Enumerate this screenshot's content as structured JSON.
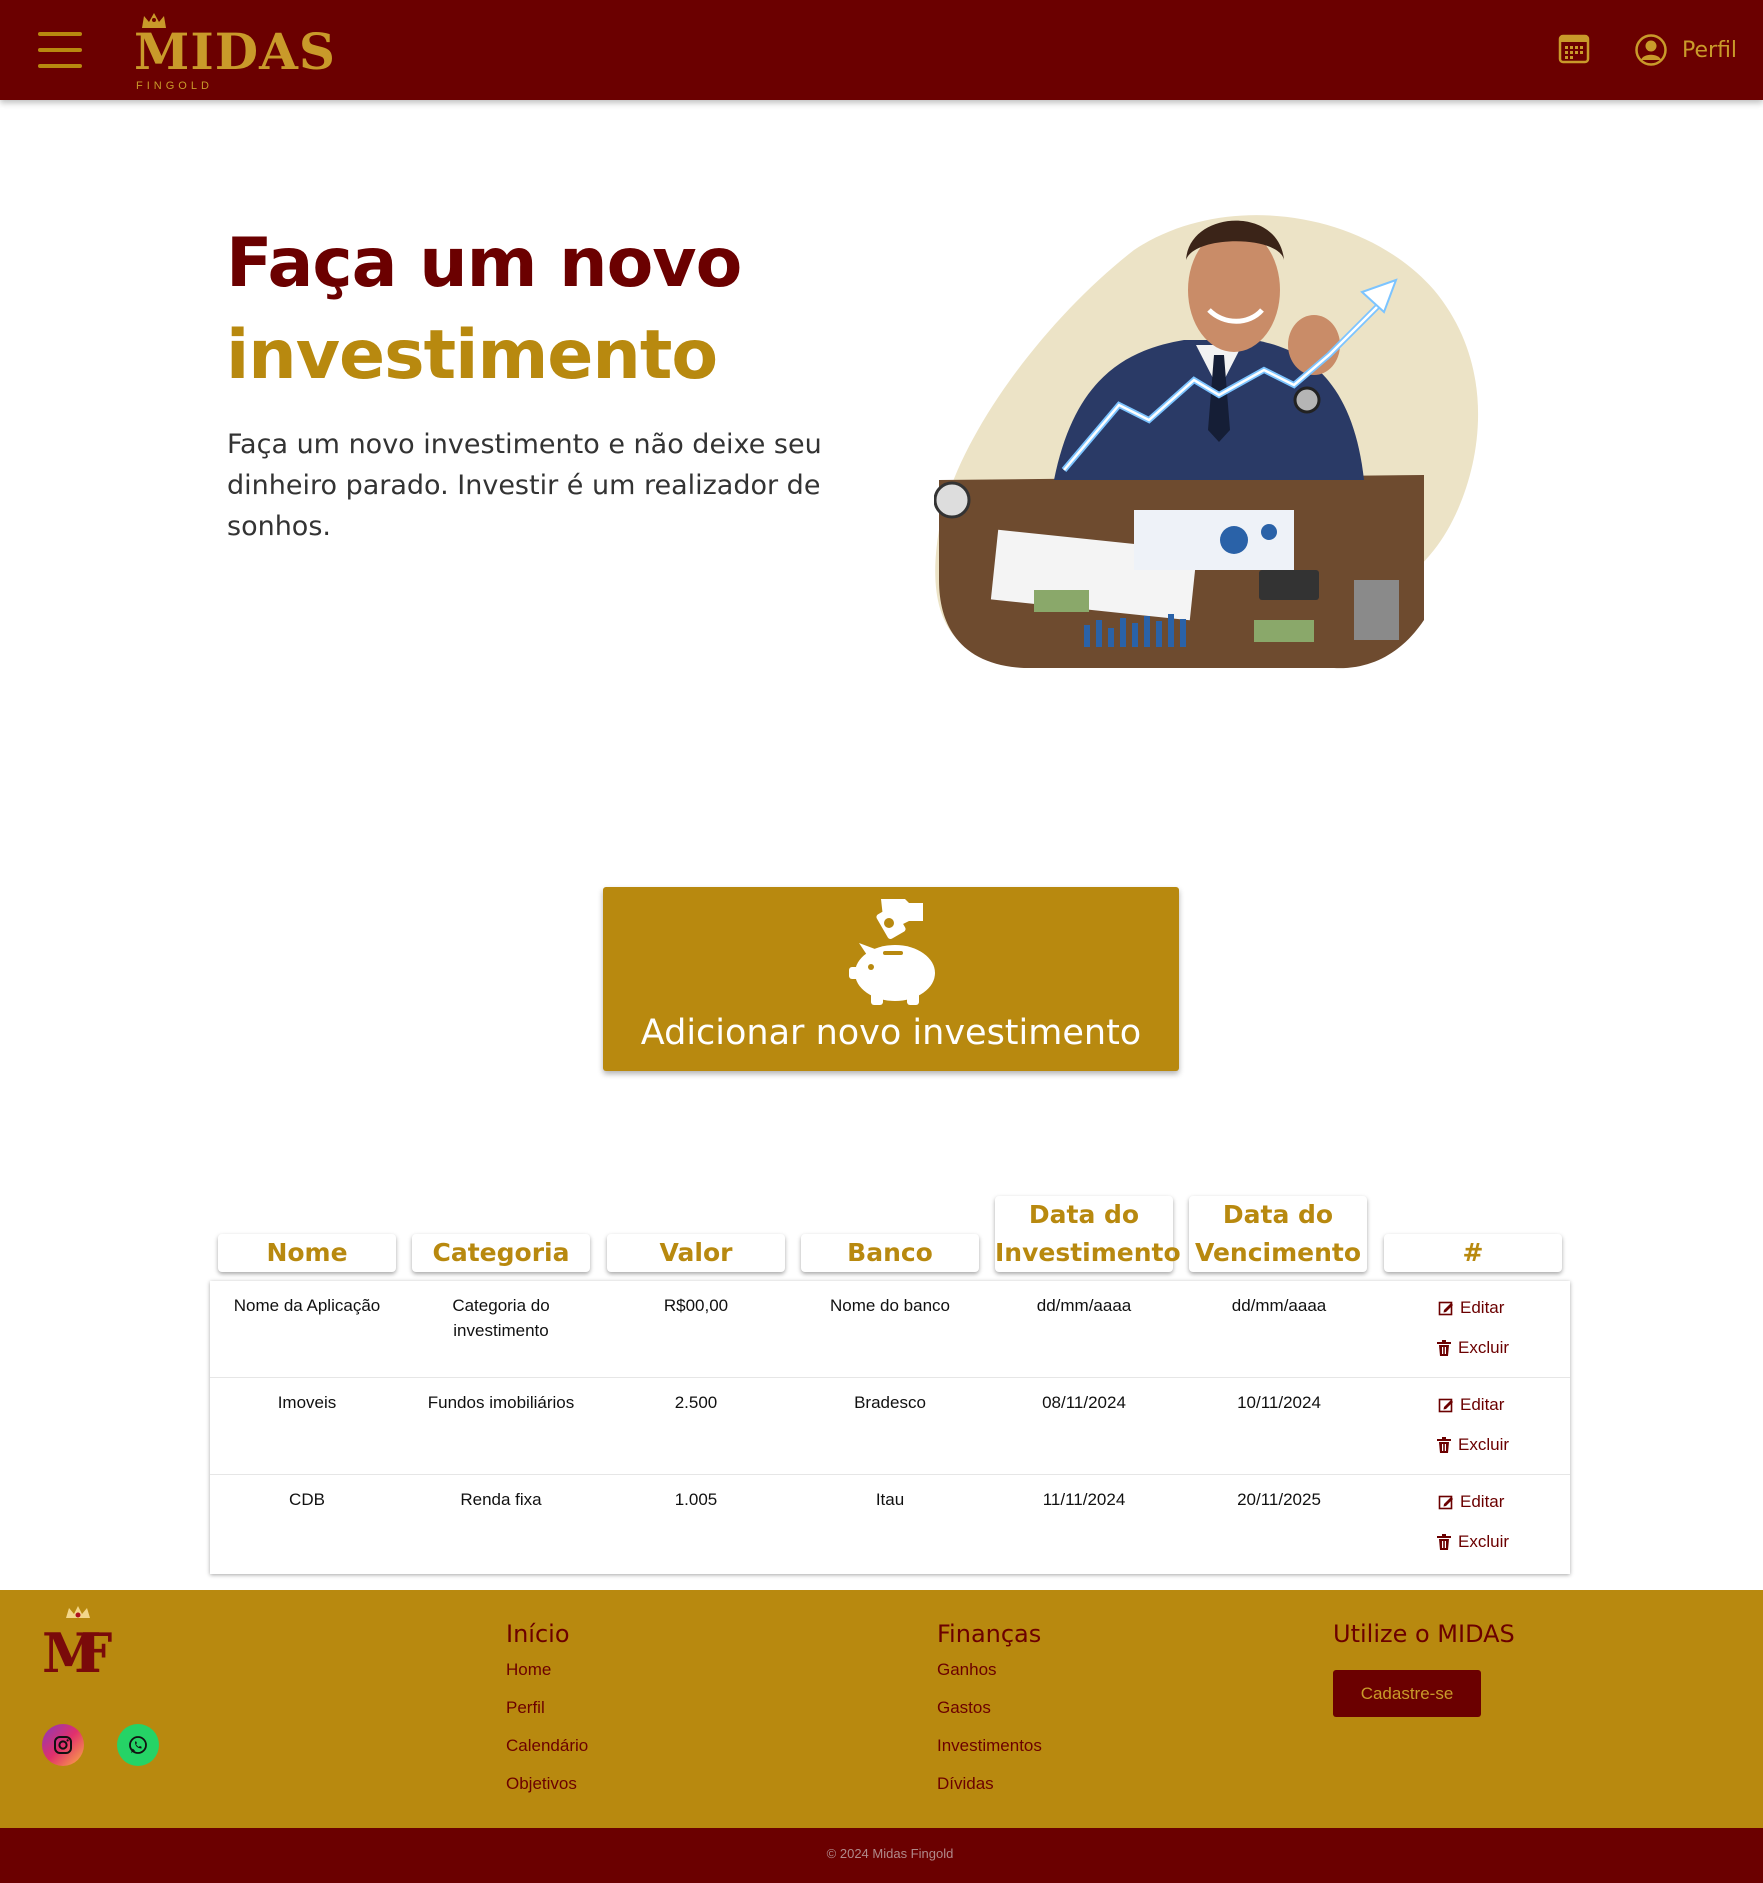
{
  "header": {
    "logo_text": "MIDAS",
    "logo_sub": "FINGOLD",
    "profile_label": "Perfil"
  },
  "hero": {
    "title_line1": "Faça um novo",
    "title_line2": "investimento",
    "description": "Faça um novo investimento e não deixe seu dinheiro parado. Investir é um realizador de sonhos."
  },
  "add_button": {
    "label": "Adicionar novo investimento"
  },
  "table": {
    "headers": [
      {
        "line1": "Nome",
        "line2": ""
      },
      {
        "line1": "Categoria",
        "line2": ""
      },
      {
        "line1": "Valor",
        "line2": ""
      },
      {
        "line1": "Banco",
        "line2": ""
      },
      {
        "line1": "Data do",
        "line2": "Investimento"
      },
      {
        "line1": "Data do",
        "line2": "Vencimento"
      },
      {
        "line1": "#",
        "line2": ""
      }
    ],
    "rows": [
      {
        "nome": "Nome da Aplicação",
        "categoria": "Categoria do investimento",
        "valor": "R$00,00",
        "banco": "Nome do banco",
        "data_investimento": "dd/mm/aaaa",
        "data_vencimento": "dd/mm/aaaa",
        "edit_label": "Editar",
        "delete_label": "Excluir"
      },
      {
        "nome": "Imoveis",
        "categoria": "Fundos imobiliários",
        "valor": "2.500",
        "banco": "Bradesco",
        "data_investimento": "08/11/2024",
        "data_vencimento": "10/11/2024",
        "edit_label": "Editar",
        "delete_label": "Excluir"
      },
      {
        "nome": "CDB",
        "categoria": "Renda fixa",
        "valor": "1.005",
        "banco": "Itau",
        "data_investimento": "11/11/2024",
        "data_vencimento": "20/11/2025",
        "edit_label": "Editar",
        "delete_label": "Excluir"
      }
    ]
  },
  "footer": {
    "columns": [
      {
        "title": "Início",
        "links": [
          "Home",
          "Perfil",
          "Calendário",
          "Objetivos"
        ]
      },
      {
        "title": "Finanças",
        "links": [
          "Ganhos",
          "Gastos",
          "Investimentos",
          "Dívidas"
        ]
      }
    ],
    "cta_title": "Utilize o MIDAS",
    "cta_button": "Cadastre-se",
    "copyright": "© 2024 Midas Fingold"
  },
  "colors": {
    "primary_dark_red": "#6b0000",
    "gold": "#b8890f",
    "logo_gold": "#c99a2a"
  },
  "icons": [
    "menu-icon",
    "crown-icon",
    "calendar-icon",
    "user-circle-icon",
    "piggy-bank-icon",
    "edit-icon",
    "trash-icon",
    "instagram-icon",
    "whatsapp-icon"
  ]
}
